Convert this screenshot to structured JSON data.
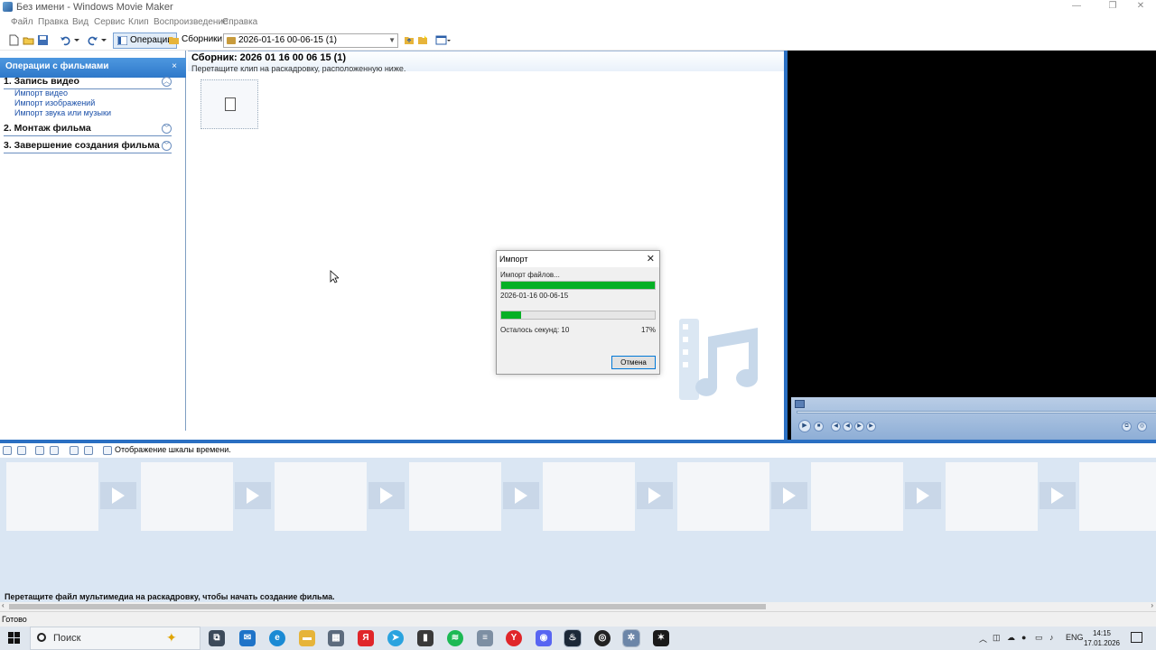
{
  "window": {
    "title": "Без имени - Windows Movie Maker",
    "minimize": "—",
    "maximize": "❐",
    "close": "✕"
  },
  "menu": [
    "Файл",
    "Правка",
    "Вид",
    "Сервис",
    "Клип",
    "Воспроизведение",
    "Справка"
  ],
  "toolbar": {
    "tasks_label": "Операции",
    "collections_label": "Сборники",
    "collection_combo": "2026-01-16 00-06-15 (1)"
  },
  "taskpane": {
    "header": "Операции с фильмами",
    "close": "×",
    "section1": "1. Запись видео",
    "links": [
      "Импорт видео",
      "Импорт изображений",
      "Импорт звука или музыки"
    ],
    "section2": "2. Монтаж фильма",
    "section3": "3. Завершение создания фильма"
  },
  "collection": {
    "title": "Сборник: 2026 01 16 00 06 15 (1)",
    "subtitle": "Перетащите клип на раскадровку, расположенную ниже."
  },
  "import_dialog": {
    "title": "Импорт",
    "close": "✕",
    "status": "Импорт файлов...",
    "overall_progress": 1.0,
    "file_name": "2026-01-16 00-06-15",
    "file_progress": 0.13,
    "remaining": "Осталось секунд: 10",
    "percent": "17%",
    "cancel_label": "Отмена"
  },
  "storyboard": {
    "show_timeline_label": "Отображение шкалы времени.",
    "hint": "Перетащите файл мультимедиа на раскадровку, чтобы начать создание фильма."
  },
  "status": "Готово",
  "taskbar": {
    "search_placeholder": "Поиск",
    "lang": "ENG",
    "time": "14:15",
    "date": "17.01.2026"
  },
  "colors": {
    "accent": "#2a6fc2",
    "progress": "#06b025",
    "storyboard_bg": "#dae6f3"
  }
}
